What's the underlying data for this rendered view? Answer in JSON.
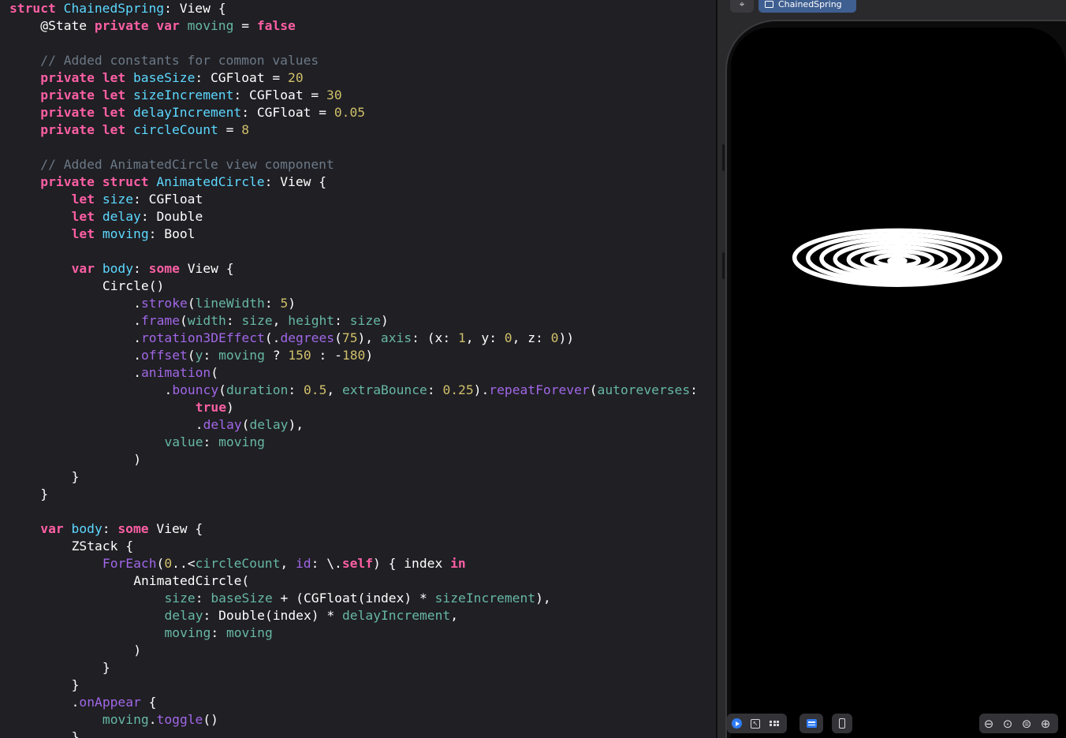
{
  "editor": {
    "lines": [
      {
        "indent": 0,
        "tokens": [
          [
            "kw",
            "struct"
          ],
          [
            "p",
            " "
          ],
          [
            "type",
            "ChainedSpring"
          ],
          [
            "p",
            ": "
          ],
          [
            "plain",
            "View {"
          ]
        ]
      },
      {
        "indent": 1,
        "tokens": [
          [
            "plain",
            "@State "
          ],
          [
            "kw",
            "private"
          ],
          [
            "p",
            " "
          ],
          [
            "kw",
            "var"
          ],
          [
            "p",
            " "
          ],
          [
            "prop",
            "moving"
          ],
          [
            "p",
            " = "
          ],
          [
            "kw",
            "false"
          ]
        ]
      },
      {
        "indent": 0,
        "tokens": []
      },
      {
        "indent": 1,
        "tokens": [
          [
            "cmt",
            "// Added constants for common values"
          ]
        ]
      },
      {
        "indent": 1,
        "tokens": [
          [
            "kw",
            "private"
          ],
          [
            "p",
            " "
          ],
          [
            "kw",
            "let"
          ],
          [
            "p",
            " "
          ],
          [
            "type",
            "baseSize"
          ],
          [
            "p",
            ": "
          ],
          [
            "plain",
            "CGFloat = "
          ],
          [
            "num",
            "20"
          ]
        ]
      },
      {
        "indent": 1,
        "tokens": [
          [
            "kw",
            "private"
          ],
          [
            "p",
            " "
          ],
          [
            "kw",
            "let"
          ],
          [
            "p",
            " "
          ],
          [
            "type",
            "sizeIncrement"
          ],
          [
            "p",
            ": "
          ],
          [
            "plain",
            "CGFloat = "
          ],
          [
            "num",
            "30"
          ]
        ]
      },
      {
        "indent": 1,
        "tokens": [
          [
            "kw",
            "private"
          ],
          [
            "p",
            " "
          ],
          [
            "kw",
            "let"
          ],
          [
            "p",
            " "
          ],
          [
            "type",
            "delayIncrement"
          ],
          [
            "p",
            ": "
          ],
          [
            "plain",
            "CGFloat = "
          ],
          [
            "num",
            "0.05"
          ]
        ]
      },
      {
        "indent": 1,
        "tokens": [
          [
            "kw",
            "private"
          ],
          [
            "p",
            " "
          ],
          [
            "kw",
            "let"
          ],
          [
            "p",
            " "
          ],
          [
            "type",
            "circleCount"
          ],
          [
            "p",
            " = "
          ],
          [
            "num",
            "8"
          ]
        ]
      },
      {
        "indent": 0,
        "tokens": []
      },
      {
        "indent": 1,
        "tokens": [
          [
            "cmt",
            "// Added AnimatedCircle view component"
          ]
        ]
      },
      {
        "indent": 1,
        "tokens": [
          [
            "kw",
            "private"
          ],
          [
            "p",
            " "
          ],
          [
            "kw",
            "struct"
          ],
          [
            "p",
            " "
          ],
          [
            "type",
            "AnimatedCircle"
          ],
          [
            "p",
            ": "
          ],
          [
            "plain",
            "View {"
          ]
        ]
      },
      {
        "indent": 2,
        "tokens": [
          [
            "kw",
            "let"
          ],
          [
            "p",
            " "
          ],
          [
            "type",
            "size"
          ],
          [
            "p",
            ": "
          ],
          [
            "plain",
            "CGFloat"
          ]
        ]
      },
      {
        "indent": 2,
        "tokens": [
          [
            "kw",
            "let"
          ],
          [
            "p",
            " "
          ],
          [
            "type",
            "delay"
          ],
          [
            "p",
            ": "
          ],
          [
            "plain",
            "Double"
          ]
        ]
      },
      {
        "indent": 2,
        "tokens": [
          [
            "kw",
            "let"
          ],
          [
            "p",
            " "
          ],
          [
            "type",
            "moving"
          ],
          [
            "p",
            ": "
          ],
          [
            "plain",
            "Bool"
          ]
        ]
      },
      {
        "indent": 0,
        "tokens": []
      },
      {
        "indent": 2,
        "tokens": [
          [
            "kw",
            "var"
          ],
          [
            "p",
            " "
          ],
          [
            "type",
            "body"
          ],
          [
            "p",
            ": "
          ],
          [
            "kw",
            "some"
          ],
          [
            "p",
            " "
          ],
          [
            "plain",
            "View {"
          ]
        ]
      },
      {
        "indent": 3,
        "tokens": [
          [
            "plain",
            "Circle()"
          ]
        ]
      },
      {
        "indent": 4,
        "tokens": [
          [
            "plain",
            "."
          ],
          [
            "method",
            "stroke"
          ],
          [
            "plain",
            "("
          ],
          [
            "prop",
            "lineWidth"
          ],
          [
            "plain",
            ": "
          ],
          [
            "num",
            "5"
          ],
          [
            "plain",
            ")"
          ]
        ]
      },
      {
        "indent": 4,
        "tokens": [
          [
            "plain",
            "."
          ],
          [
            "method",
            "frame"
          ],
          [
            "plain",
            "("
          ],
          [
            "prop",
            "width"
          ],
          [
            "plain",
            ": "
          ],
          [
            "prop",
            "size"
          ],
          [
            "plain",
            ", "
          ],
          [
            "prop",
            "height"
          ],
          [
            "plain",
            ": "
          ],
          [
            "prop",
            "size"
          ],
          [
            "plain",
            ")"
          ]
        ]
      },
      {
        "indent": 4,
        "tokens": [
          [
            "plain",
            "."
          ],
          [
            "method",
            "rotation3DEffect"
          ],
          [
            "plain",
            "(."
          ],
          [
            "method",
            "degrees"
          ],
          [
            "plain",
            "("
          ],
          [
            "num",
            "75"
          ],
          [
            "plain",
            "), "
          ],
          [
            "prop",
            "axis"
          ],
          [
            "plain",
            ": (x: "
          ],
          [
            "num",
            "1"
          ],
          [
            "plain",
            ", y: "
          ],
          [
            "num",
            "0"
          ],
          [
            "plain",
            ", z: "
          ],
          [
            "num",
            "0"
          ],
          [
            "plain",
            "))"
          ]
        ]
      },
      {
        "indent": 4,
        "tokens": [
          [
            "plain",
            "."
          ],
          [
            "method",
            "offset"
          ],
          [
            "plain",
            "("
          ],
          [
            "prop",
            "y"
          ],
          [
            "plain",
            ": "
          ],
          [
            "prop",
            "moving"
          ],
          [
            "plain",
            " ? "
          ],
          [
            "num",
            "150"
          ],
          [
            "plain",
            " : -"
          ],
          [
            "num",
            "180"
          ],
          [
            "plain",
            ")"
          ]
        ]
      },
      {
        "indent": 4,
        "tokens": [
          [
            "plain",
            "."
          ],
          [
            "method",
            "animation"
          ],
          [
            "plain",
            "("
          ]
        ]
      },
      {
        "indent": 5,
        "tokens": [
          [
            "plain",
            "."
          ],
          [
            "method",
            "bouncy"
          ],
          [
            "plain",
            "("
          ],
          [
            "prop",
            "duration"
          ],
          [
            "plain",
            ": "
          ],
          [
            "num",
            "0.5"
          ],
          [
            "plain",
            ", "
          ],
          [
            "prop",
            "extraBounce"
          ],
          [
            "plain",
            ": "
          ],
          [
            "num",
            "0.25"
          ],
          [
            "plain",
            ")."
          ],
          [
            "method",
            "repeatForever"
          ],
          [
            "plain",
            "("
          ],
          [
            "prop",
            "autoreverses"
          ],
          [
            "plain",
            ":"
          ]
        ]
      },
      {
        "indent": 6,
        "tokens": [
          [
            "kw",
            "true"
          ],
          [
            "plain",
            ")"
          ]
        ]
      },
      {
        "indent": 6,
        "tokens": [
          [
            "plain",
            "."
          ],
          [
            "method",
            "delay"
          ],
          [
            "plain",
            "("
          ],
          [
            "prop",
            "delay"
          ],
          [
            "plain",
            "),"
          ]
        ]
      },
      {
        "indent": 5,
        "tokens": [
          [
            "prop",
            "value"
          ],
          [
            "plain",
            ": "
          ],
          [
            "prop",
            "moving"
          ]
        ]
      },
      {
        "indent": 4,
        "tokens": [
          [
            "plain",
            ")"
          ]
        ]
      },
      {
        "indent": 2,
        "tokens": [
          [
            "plain",
            "}"
          ]
        ]
      },
      {
        "indent": 1,
        "tokens": [
          [
            "plain",
            "}"
          ]
        ]
      },
      {
        "indent": 0,
        "tokens": []
      },
      {
        "indent": 1,
        "tokens": [
          [
            "kw",
            "var"
          ],
          [
            "p",
            " "
          ],
          [
            "type",
            "body"
          ],
          [
            "p",
            ": "
          ],
          [
            "kw",
            "some"
          ],
          [
            "p",
            " "
          ],
          [
            "plain",
            "View {"
          ]
        ]
      },
      {
        "indent": 2,
        "tokens": [
          [
            "plain",
            "ZStack {"
          ]
        ]
      },
      {
        "indent": 3,
        "tokens": [
          [
            "method",
            "ForEach"
          ],
          [
            "plain",
            "("
          ],
          [
            "num",
            "0"
          ],
          [
            "plain",
            "..<"
          ],
          [
            "prop",
            "circleCount"
          ],
          [
            "plain",
            ", "
          ],
          [
            "method",
            "id"
          ],
          [
            "plain",
            ": \\."
          ],
          [
            "kw",
            "self"
          ],
          [
            "plain",
            ") { index "
          ],
          [
            "kw",
            "in"
          ]
        ]
      },
      {
        "indent": 4,
        "tokens": [
          [
            "plain",
            "AnimatedCircle("
          ]
        ]
      },
      {
        "indent": 5,
        "tokens": [
          [
            "prop",
            "size"
          ],
          [
            "plain",
            ": "
          ],
          [
            "prop",
            "baseSize"
          ],
          [
            "plain",
            " + ("
          ],
          [
            "plain",
            "CGFloat"
          ],
          [
            "plain",
            "(index) * "
          ],
          [
            "prop",
            "sizeIncrement"
          ],
          [
            "plain",
            "),"
          ]
        ]
      },
      {
        "indent": 5,
        "tokens": [
          [
            "prop",
            "delay"
          ],
          [
            "plain",
            ": "
          ],
          [
            "plain",
            "Double"
          ],
          [
            "plain",
            "(index) * "
          ],
          [
            "prop",
            "delayIncrement"
          ],
          [
            "plain",
            ","
          ]
        ]
      },
      {
        "indent": 5,
        "tokens": [
          [
            "prop",
            "moving"
          ],
          [
            "plain",
            ": "
          ],
          [
            "prop",
            "moving"
          ]
        ]
      },
      {
        "indent": 4,
        "tokens": [
          [
            "plain",
            ")"
          ]
        ]
      },
      {
        "indent": 3,
        "tokens": [
          [
            "plain",
            "}"
          ]
        ]
      },
      {
        "indent": 2,
        "tokens": [
          [
            "plain",
            "}"
          ]
        ]
      },
      {
        "indent": 2,
        "tokens": [
          [
            "plain",
            "."
          ],
          [
            "method",
            "onAppear"
          ],
          [
            "plain",
            " {"
          ]
        ]
      },
      {
        "indent": 3,
        "tokens": [
          [
            "prop",
            "moving"
          ],
          [
            "plain",
            "."
          ],
          [
            "method",
            "toggle"
          ],
          [
            "plain",
            "()"
          ]
        ]
      },
      {
        "indent": 2,
        "tokens": [
          [
            "plain",
            "}"
          ]
        ]
      }
    ]
  },
  "canvas": {
    "pin_icon": "pin-icon",
    "preview_tab_label": "ChainedSpring",
    "preview_tab_icon": "window-icon",
    "rings": {
      "count": 8,
      "color": "#ffffff",
      "background": "#000000"
    },
    "toolbar_left": [
      "live-preview-icon",
      "selectable-mode-icon",
      "grid-variants-icon"
    ],
    "toolbar_mid": [
      "variants-icon"
    ],
    "toolbar_device": [
      "device-settings-icon"
    ],
    "zoom_buttons": [
      "zoom-out-icon",
      "zoom-to-fit-icon",
      "zoom-100-icon",
      "zoom-in-icon"
    ]
  },
  "colors": {
    "keyword": "#fc5fa3",
    "property": "#67b7a4",
    "type_decl": "#5dd8ff",
    "number": "#d0bf69",
    "comment": "#6c7986",
    "method": "#a167e6",
    "accent": "#2f7cf6"
  }
}
